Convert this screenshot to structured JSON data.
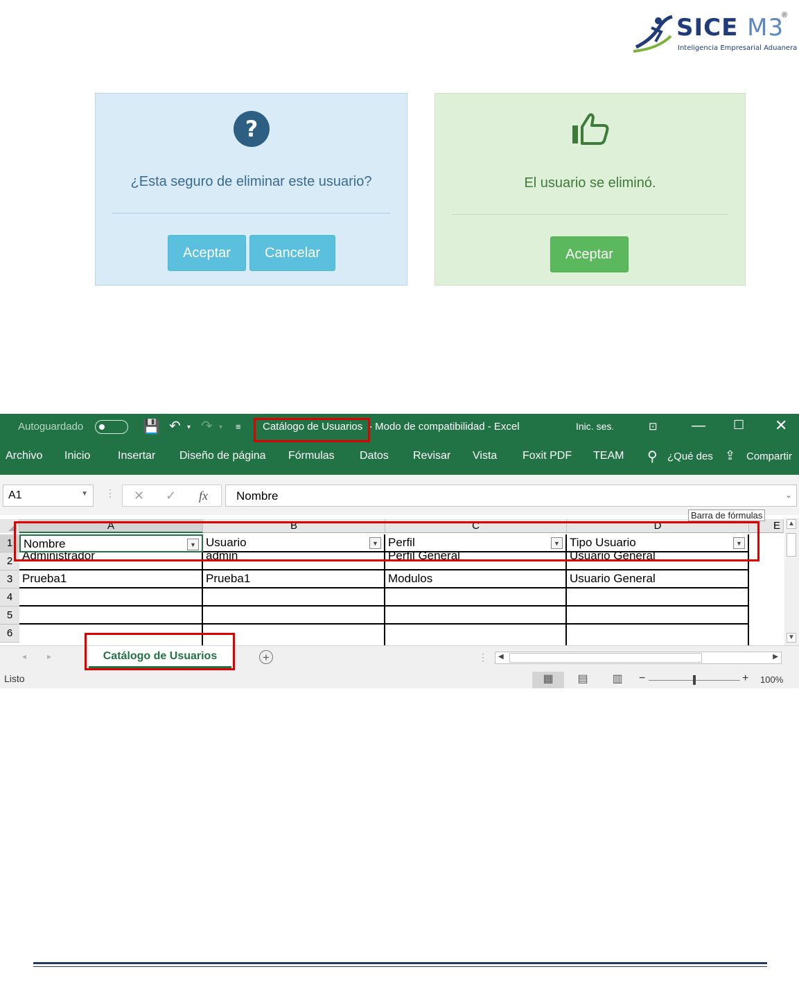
{
  "logo": {
    "brand": "SICE M3",
    "tagline": "Inteligencia Empresarial Aduanera"
  },
  "dialog_confirm": {
    "icon": "question-circle-icon",
    "message": "¿Esta seguro de eliminar este usuario?",
    "accept_label": "Aceptar",
    "cancel_label": "Cancelar",
    "colors": {
      "background": "#d8ebf6",
      "button": "#5bc0de",
      "text": "#3a6a92"
    }
  },
  "dialog_success": {
    "icon": "thumbs-up-icon",
    "message": "El usuario se eliminó.",
    "accept_label": "Aceptar",
    "colors": {
      "background": "#dff0d8",
      "button": "#5cb85c",
      "text": "#3e7a3a"
    }
  },
  "excel": {
    "titlebar": {
      "autosave_label": "Autoguardado",
      "filename": "Catálogo de Usuarios",
      "mode": "-  Modo de compatibilidad  -  Excel",
      "signin": "Inic. ses.",
      "accent": "#217346"
    },
    "ribbon_tabs": [
      "Archivo",
      "Inicio",
      "Insertar",
      "Diseño de página",
      "Fórmulas",
      "Datos",
      "Revisar",
      "Vista",
      "Foxit PDF",
      "TEAM"
    ],
    "ribbon_search": "¿Qué des",
    "ribbon_share": "Compartir",
    "name_box": "A1",
    "formula_value": "Nombre",
    "formula_tooltip": "Barra de fórmulas",
    "columns": [
      "A",
      "B",
      "C",
      "D",
      "E"
    ],
    "rows": [
      "1",
      "2",
      "3",
      "4",
      "5",
      "6"
    ],
    "cells": [
      [
        "Nombre",
        "Usuario",
        "Perfil",
        "Tipo Usuario"
      ],
      [
        "Administrador",
        "admin",
        "Perfil General",
        "Usuario General"
      ],
      [
        "Prueba1",
        "Prueba1",
        "Modulos",
        "Usuario General"
      ],
      [
        "",
        "",
        "",
        ""
      ],
      [
        "",
        "",
        "",
        ""
      ],
      [
        "",
        "",
        "",
        ""
      ]
    ],
    "sheet_tab": "Catálogo de Usuarios",
    "status": "Listo",
    "zoom": "100%"
  }
}
